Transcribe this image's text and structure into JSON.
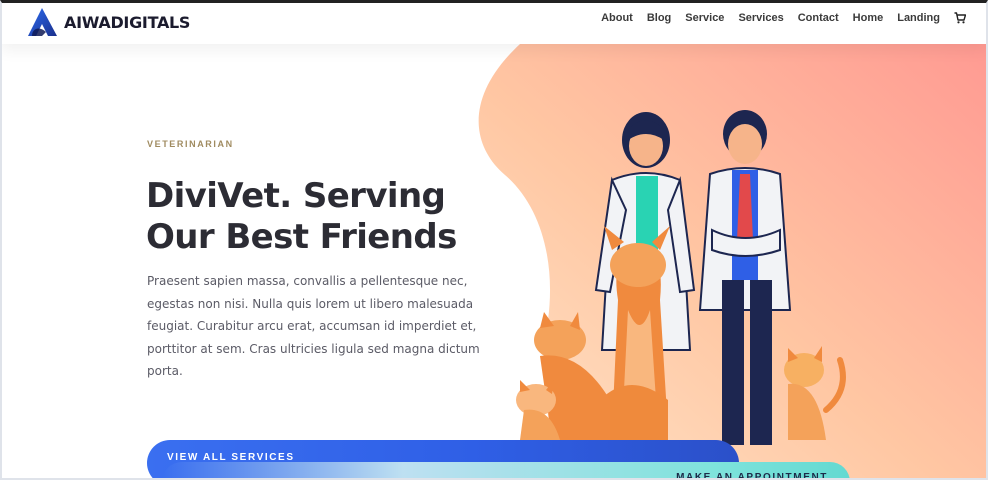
{
  "brand": {
    "name": "AIWADIGITALS"
  },
  "nav": {
    "items": [
      "About",
      "Blog",
      "Service",
      "Services",
      "Contact",
      "Home",
      "Landing"
    ]
  },
  "hero": {
    "eyebrow": "VETERINARIAN",
    "headline_line1": "DiviVet. Serving",
    "headline_line2": "Our Best Friends",
    "body": "Praesent sapien massa, convallis a pellentesque nec, egestas non nisi. Nulla quis lorem ut libero malesuada feugiat. Curabitur arcu erat, accumsan id imperdiet et, porttitor at sem. Cras ultricies ligula sed magna dictum porta."
  },
  "buttons": {
    "services": "VIEW ALL SERVICES",
    "appointment": "MAKE AN APPOINTMENT"
  },
  "icons": {
    "cart": "cart-icon",
    "logo": "aiwa-logo-mark"
  },
  "colors": {
    "primary_blue": "#2f5fe6",
    "accent_teal": "#63d9d1",
    "hero_gradient_start": "#ffd9b8",
    "hero_gradient_end": "#ff9f95",
    "eyebrow": "#a08b60"
  }
}
